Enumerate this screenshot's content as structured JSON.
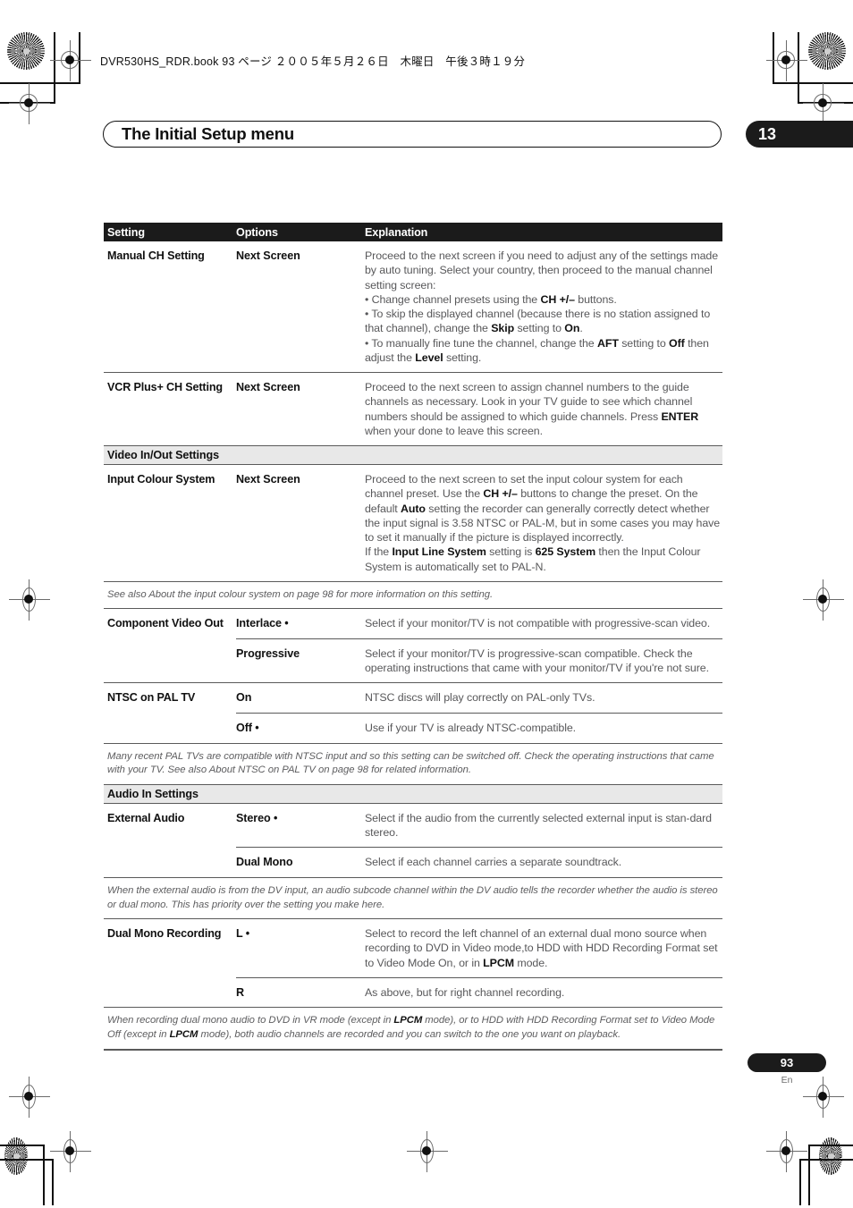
{
  "header": {
    "book_line": "DVR530HS_RDR.book  93 ページ  ２００５年５月２６日　木曜日　午後３時１９分",
    "title": "The Initial Setup menu",
    "chapter_number": "13"
  },
  "footer": {
    "page_number": "93",
    "language_mark": "En"
  },
  "table": {
    "headers": {
      "setting": "Setting",
      "options": "Options",
      "explanation": "Explanation"
    },
    "rows": [
      {
        "type": "row",
        "setting": "Manual CH Setting",
        "options": "Next Screen",
        "explanation_html": "Proceed to the next screen if you need to adjust any of the settings made by auto tuning. Select your country, then proceed to the manual channel setting screen:<br>• Change  channel presets using the <b>CH +/&ndash;</b> buttons.<br>• To skip the displayed channel (because there is no station assigned to that channel), change the <b>Skip</b> setting to <b>On</b>.<br>• To manually fine tune the channel, change the <b>AFT</b> setting to <b>Off</b> then adjust the <b>Level</b> setting."
      },
      {
        "type": "row",
        "setting": "VCR Plus+ CH Setting",
        "options": "Next Screen",
        "explanation_html": "Proceed to the next screen to assign channel numbers to the guide channels as necessary. Look in your TV guide to see which channel numbers should be assigned to which guide channels. Press <b>ENTER</b> when your done to leave this screen."
      },
      {
        "type": "section",
        "label": "Video In/Out Settings"
      },
      {
        "type": "row",
        "setting": "Input Colour System",
        "options": "Next Screen",
        "explanation_html": "Proceed to the next screen to set the input colour system for each channel preset. Use the <b>CH +/&ndash;</b> buttons to change the preset. On the default <b>Auto</b> setting the recorder can generally correctly detect whether the input signal is 3.58 NTSC or PAL-M, but in some cases you may have to set it manually if the picture is displayed incorrectly.<br>If the <b>Input Line System</b> setting is <b>625 System</b> then the Input Colour System is automatically set to PAL-N."
      },
      {
        "type": "note",
        "note_html": "See also About the input colour system on page 98 for more information on this setting."
      },
      {
        "type": "multirow",
        "setting": "Component Video Out",
        "subrows": [
          {
            "options": "Interlace •",
            "explanation_html": "Select if your monitor/TV is not compatible with progressive-scan video."
          },
          {
            "options": "Progressive",
            "explanation_html": "Select if your monitor/TV is progressive-scan compatible. Check the operating instructions that came with your monitor/TV if you're not sure."
          }
        ]
      },
      {
        "type": "multirow",
        "setting": "NTSC on PAL TV",
        "subrows": [
          {
            "options": "On",
            "explanation_html": "NTSC discs will play correctly on PAL-only TVs."
          },
          {
            "options": "Off •",
            "explanation_html": "Use if your TV is already NTSC-compatible."
          }
        ]
      },
      {
        "type": "note",
        "note_html": "Many recent PAL TVs are compatible with NTSC input and so this setting can be switched off. Check the operating instructions that came with your TV. See also About NTSC on PAL TV on page 98 for related information."
      },
      {
        "type": "section",
        "label": "Audio In Settings"
      },
      {
        "type": "multirow",
        "setting": "External Audio",
        "subrows": [
          {
            "options": "Stereo •",
            "explanation_html": "Select if the audio from the currently selected external input is stan-dard stereo."
          },
          {
            "options": "Dual Mono",
            "explanation_html": "Select if each channel carries a separate soundtrack."
          }
        ]
      },
      {
        "type": "note",
        "note_html": "When the external audio is from the DV input, an audio subcode channel within the DV audio tells the recorder whether the audio is stereo or dual mono. This has priority over the setting you make here."
      },
      {
        "type": "multirow",
        "setting": "Dual Mono Recording",
        "subrows": [
          {
            "options": "L •",
            "explanation_html": "Select to record the left channel of an external dual mono source when recording to DVD in Video mode,to HDD with HDD Recording Format set to Video Mode On, or in <b>LPCM</b> mode."
          },
          {
            "options": "R",
            "explanation_html": "As above, but for right channel recording."
          }
        ]
      },
      {
        "type": "note",
        "note_html": "When recording dual mono audio to DVD in VR mode (except in <b>LPCM</b> mode), or to HDD with HDD Recording Format set to Video Mode Off (except in <b>LPCM</b> mode), both audio channels are recorded and you can switch to the one you want on playback."
      }
    ]
  }
}
